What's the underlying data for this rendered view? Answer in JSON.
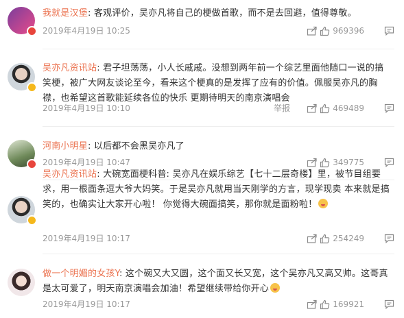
{
  "colors": {
    "username": "#eb7350",
    "text": "#333333",
    "meta": "#999999"
  },
  "comments": [
    {
      "username": "我就是汉堡",
      "content": ": 客观评价，吴亦凡将自己的梗做首歌，而不是去回避，值得尊敬。",
      "time": "2019年4月19日 10:25",
      "likes": "969396",
      "report": "",
      "avatar_desc": "pink-purple avatar",
      "emoji": ""
    },
    {
      "username": "吴亦凡资讯站",
      "content": ": 君子坦荡荡，小人长戚戚。没想到两年前一个综艺里面他随口一说的搞笑梗，被广大网友谈论至今，看来这个梗真的是发挥了应有的价值。佩服吴亦凡的胸襟，也希望这首歌能延续各位的快乐 更期待明天的南京演唱会",
      "time": "2019年4月19日 10:10",
      "likes": "469489",
      "report": "举报",
      "avatar_desc": "man portrait avatar",
      "emoji": ""
    },
    {
      "username": "河南小明星",
      "content": ": 以后都不会黑吴亦凡了",
      "time": "2019年4月19日 10:47",
      "likes": "349775",
      "report": "",
      "avatar_desc": "green avatar",
      "emoji": ""
    },
    {
      "username": "吴亦凡资讯站",
      "content": ": 大碗宽面梗科普: 吴亦凡在娱乐综艺【七十二层奇楼】里，被节目组要求，用一根面条逗大爷大妈笑。于是吴亦凡就用当天刚学的方言，现学现卖 本来就是搞笑的，也确实让大家开心啦！ 你觉得大碗面搞笑，那你就是面粉啦！",
      "time": "2019年4月19日 10:17",
      "likes": "254249",
      "report": "",
      "avatar_desc": "man portrait avatar",
      "emoji": "tongue-emoji"
    },
    {
      "username": "做一个明媚的女孩Y",
      "content": ": 这个碗又大又圆，这个面又长又宽，这个吴亦凡又高又帅。这哥真是太可爱了，明天南京演唱会加油！希望继续带给你开心",
      "time": "2019年4月19日 10:17",
      "likes": "169921",
      "report": "",
      "avatar_desc": "girl avatar",
      "emoji": "grin-emoji"
    }
  ]
}
